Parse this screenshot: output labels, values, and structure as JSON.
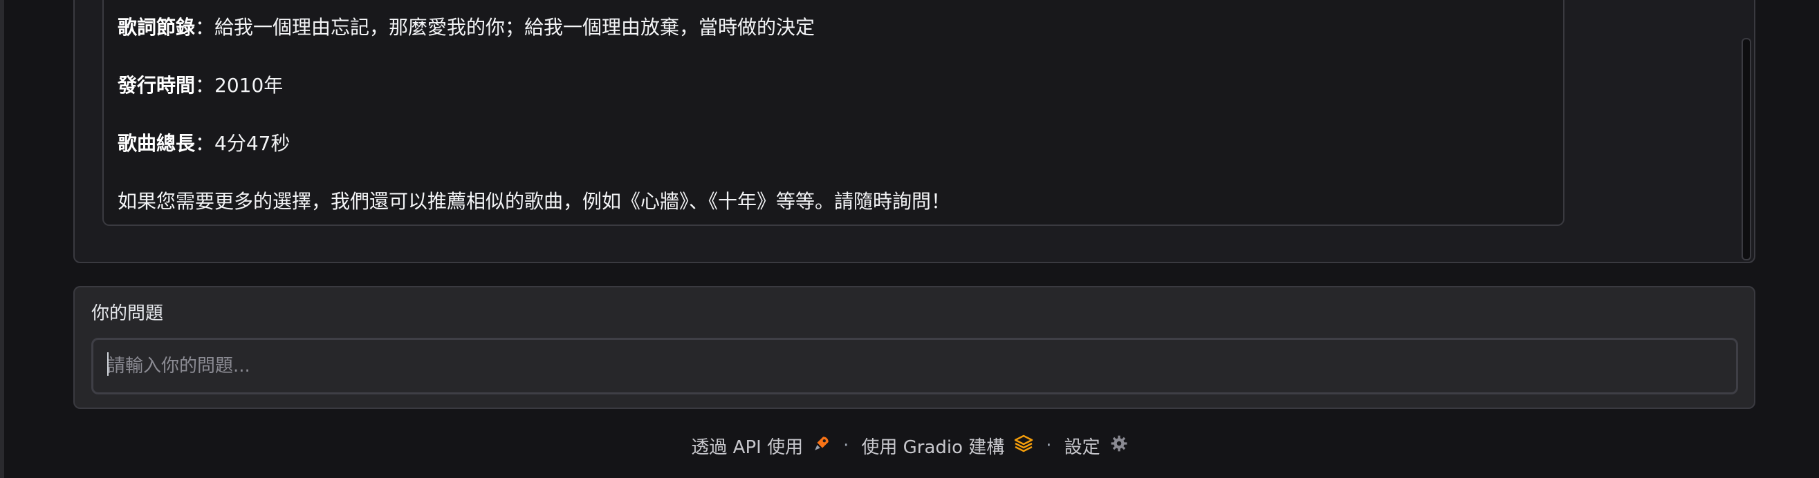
{
  "chat": {
    "lines": [
      {
        "label": "歌詞節錄",
        "sep": "：",
        "text": "給我一個理由忘記，那麼愛我的你；給我一個理由放棄，當時做的決定"
      },
      {
        "label": "發行時間",
        "sep": "：",
        "text": "2010年"
      },
      {
        "label": "歌曲總長",
        "sep": "：",
        "text": "4分47秒"
      }
    ],
    "closing": "如果您需要更多的選擇，我們還可以推薦相似的歌曲，例如《心牆》、《十年》等等。請隨時詢問！"
  },
  "input": {
    "label": "你的問題",
    "placeholder": "請輸入你的問題...",
    "value": ""
  },
  "footer": {
    "api_label": "透過 API 使用",
    "separator": "·",
    "gradio_label": "使用 Gradio 建構",
    "settings_label": "設定",
    "icons": [
      "rocket-icon",
      "gradio-logo-icon",
      "gear-icon"
    ]
  },
  "colors": {
    "background": "#141417",
    "panel": "#1c1c20",
    "input_panel": "#27272a",
    "border": "#3a3a40",
    "rocket_accent": "#f97316",
    "gradio_accent": "#f59e0b"
  }
}
